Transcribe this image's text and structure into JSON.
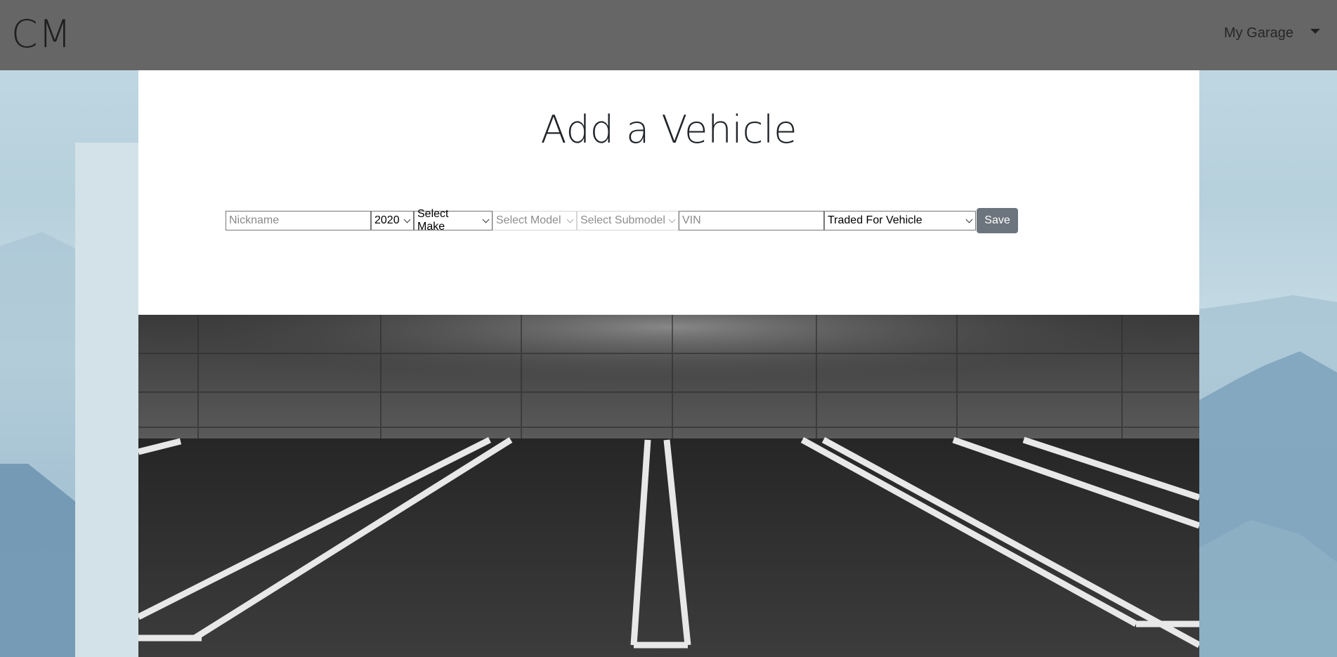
{
  "nav": {
    "brand": "CM",
    "menu_label": "My Garage"
  },
  "page": {
    "title": "Add a Vehicle"
  },
  "form": {
    "nickname_placeholder": "Nickname",
    "year_value": "2020",
    "make_value": "Select Make",
    "model_value": "Select Model",
    "submodel_value": "Select Submodel",
    "vin_placeholder": "VIN",
    "acquisition_value": "Traded For Vehicle",
    "save_label": "Save"
  },
  "icons": {
    "dropdown": "caret-down-icon",
    "select": "chevron-down-icon"
  },
  "colors": {
    "navbar": "#666666",
    "save_button": "#6c757d",
    "background": "#c3dae4"
  }
}
